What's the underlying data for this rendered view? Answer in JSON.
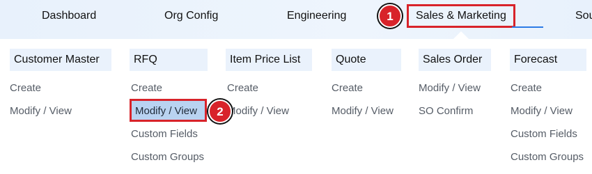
{
  "nav": {
    "items": [
      "Dashboard",
      "Org Config",
      "Engineering",
      "Sales & Marketing",
      "Sou"
    ]
  },
  "steps": [
    "1",
    "2"
  ],
  "menu": {
    "columns": [
      {
        "header": "Customer Master",
        "links": [
          "Create",
          "Modify / View"
        ]
      },
      {
        "header": "RFQ",
        "links": [
          "Create",
          "Modify / View",
          "Custom Fields",
          "Custom Groups"
        ]
      },
      {
        "header": "Item Price List",
        "links": [
          "Create",
          "Modify / View"
        ]
      },
      {
        "header": "Quote",
        "links": [
          "Create",
          "Modify / View"
        ]
      },
      {
        "header": "Sales Order",
        "links": [
          "Modify / View",
          "SO Confirm"
        ]
      },
      {
        "header": "Forecast",
        "links": [
          "Create",
          "Modify / View",
          "Custom Fields",
          "Custom Groups"
        ]
      }
    ]
  },
  "colors": {
    "highlight_border": "#d8232a",
    "badge": "#d8232a",
    "nav_background": "#e8f1fc",
    "column_header_background": "#eaf2fc",
    "selected_link_background": "#b9d3f1"
  }
}
